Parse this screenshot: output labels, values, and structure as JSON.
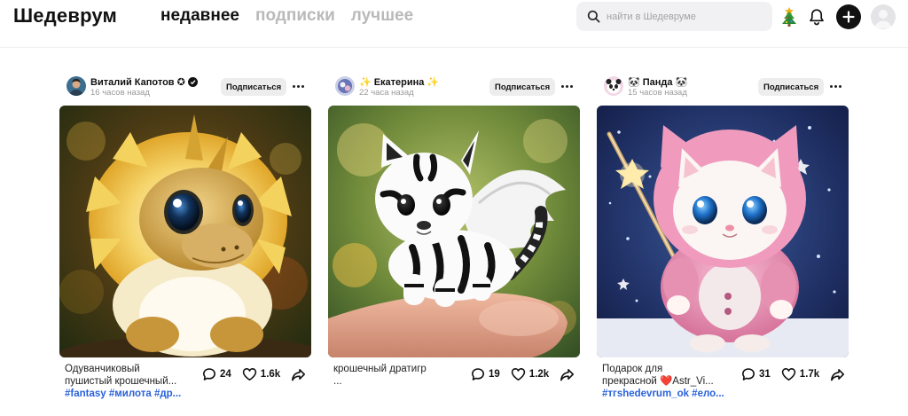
{
  "header": {
    "logo": "Шедеврум",
    "tabs": [
      {
        "label": "недавнее",
        "active": true
      },
      {
        "label": "подписки",
        "active": false
      },
      {
        "label": "лучшее",
        "active": false
      }
    ],
    "search": {
      "placeholder": "найти в Шедевруме",
      "value": ""
    },
    "icons": [
      "search-icon",
      "christmas-tree-icon",
      "bell-icon",
      "plus-icon",
      "user-avatar-icon"
    ]
  },
  "colors": {
    "accent": "#111111",
    "tag_link": "#2a62d9",
    "tab_inactive": "#b9b9b9",
    "search_bg": "#f1f1f3"
  },
  "posts": [
    {
      "author": "Виталий Капотов",
      "author_suffix": "✪",
      "verified": true,
      "time": "16 часов назад",
      "subscribe_label": "Подписаться",
      "caption_line1": "Одуванчиковый",
      "caption_line2": "пушистый крошечный...",
      "tags": "#fantasy #милота #др...",
      "comments": "24",
      "likes": "1.6k",
      "image_subject": "fluffy golden dandelion dragon"
    },
    {
      "author": "Екатерина",
      "author_prefix": "✨",
      "author_suffix": "✨",
      "verified": false,
      "time": "22 часа назад",
      "subscribe_label": "Подписаться",
      "caption_line1": "крошечный дратигр",
      "caption_line2": "...",
      "tags": "",
      "comments": "19",
      "likes": "1.2k",
      "image_subject": "tiny winged zebra-striped tiger cub on a fingertip"
    },
    {
      "author": "Панда",
      "author_prefix": "🐼",
      "author_suffix": "🐼",
      "verified": false,
      "time": "15 часов назад",
      "subscribe_label": "Подписаться",
      "caption_line1": "Подарок для",
      "caption_line2": "прекрасной ❤️Astr_Vi...",
      "tags": "#тгshedevrum_ok #ело...",
      "comments": "31",
      "likes": "1.7k",
      "image_subject": "kitten in pink hooded coat holding a star wand"
    }
  ]
}
